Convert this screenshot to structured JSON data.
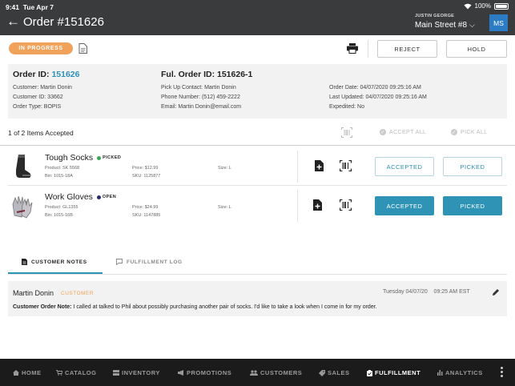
{
  "status_bar": {
    "time": "9:41",
    "date": "Tue Apr 7",
    "battery": "100%"
  },
  "header": {
    "title": "Order #151626",
    "user_name": "JUSTIN GEORGE",
    "store": "Main Street #8",
    "avatar_initials": "MS"
  },
  "actions": {
    "status": "IN PROGRESS",
    "status_color": "#f0a25a",
    "reject_label": "REJECT",
    "hold_label": "HOLD"
  },
  "order_info": {
    "order_id_label": "Order ID:",
    "order_id": "151626",
    "customer": "Customer: Martin Donin",
    "customer_id": "Customer ID: 33662",
    "order_type": "Order Type: BOPIS",
    "ful_order_id": "Ful. Order ID: 151626-1",
    "pickup_contact": "Pick Up Contact: Martin Donin",
    "phone": "Phone Number: (512) 459-2222",
    "email": "Email: Martin Donin@email.com",
    "order_date": "Order Date: 04/07/2020 09:25:16 AM",
    "last_updated": "Last Updated: 04/07/2020 09:25:16 AM",
    "expedited": "Expedited: No"
  },
  "items_header": {
    "count_text": "1 of 2 Items Accepted",
    "accept_all": "ACCEPT ALL",
    "pick_all": "PICK ALL"
  },
  "items": [
    {
      "name": "Tough Socks",
      "state": "PICKED",
      "state_color": "#3aa655",
      "product": "Product: SK 5568",
      "bin": "Bin: 1015-18A",
      "price": "Price: $12.99",
      "sku": "SKU: 1125877",
      "size": "Size: L",
      "accept_label": "ACCEPTED",
      "pick_label": "PICKED",
      "thumb_icon": "sock-icon"
    },
    {
      "name": "Work Gloves",
      "state": "OPEN",
      "state_color": "#2a2a6a",
      "product": "Product: GL1355",
      "bin": "Bin: 1015-16B",
      "price": "Price: $24.99",
      "sku": "SKU: 1147885",
      "size": "Size: L",
      "accept_label": "ACCEPTED",
      "pick_label": "PICKED",
      "thumb_icon": "glove-icon"
    }
  ],
  "tabs": [
    {
      "label": "CUSTOMER NOTES",
      "icon": "note-icon",
      "active": true
    },
    {
      "label": "FULFILLMENT LOG",
      "icon": "chat-icon",
      "active": false
    }
  ],
  "note": {
    "author": "Martin Donin",
    "role": "CUSTOMER",
    "date": "Tuesday 04/07/20    09:25 AM EST",
    "label": "Customer Order Note:",
    "text": " I called at talked to Phil about possibly purchasing another pair of socks. I'd like to take a look when I come in for my order."
  },
  "accent_color": "#2e93b5",
  "bottom_nav": [
    {
      "label": "HOME",
      "icon": "home-icon"
    },
    {
      "label": "CATALOG",
      "icon": "cart-icon"
    },
    {
      "label": "INVENTORY",
      "icon": "inventory-icon"
    },
    {
      "label": "PROMOTIONS",
      "icon": "megaphone-icon"
    },
    {
      "label": "CUSTOMERS",
      "icon": "people-icon"
    },
    {
      "label": "SALES",
      "icon": "tag-icon"
    },
    {
      "label": "FULFILLMENT",
      "icon": "clipboard-icon",
      "active": true
    },
    {
      "label": "ANALYTICS",
      "icon": "bar-chart-icon"
    }
  ]
}
